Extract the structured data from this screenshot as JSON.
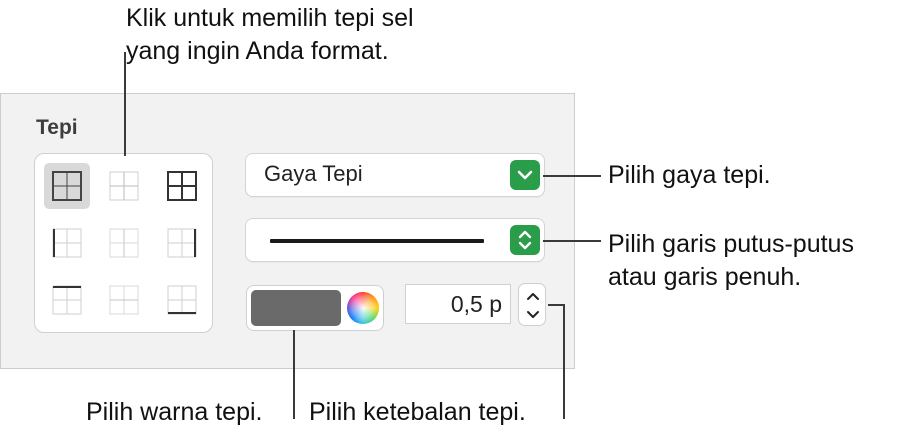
{
  "callouts": {
    "top_line1": "Klik untuk memilih tepi sel",
    "top_line2": "yang ingin Anda format.",
    "style": "Pilih gaya tepi.",
    "line_line1": "Pilih garis putus-putus",
    "line_line2": "atau garis penuh.",
    "color": "Pilih warna tepi.",
    "thickness": "Pilih ketebalan tepi."
  },
  "panel": {
    "section_title": "Tepi",
    "border_style_dropdown": "Gaya Tepi",
    "line_type": "solid",
    "thickness_value": "0,5 p",
    "border_color": "#6a6a6a",
    "accent": "#2a9d4a"
  },
  "border_buttons": [
    {
      "icon": "all-borders-icon",
      "selected": true
    },
    {
      "icon": "inside-borders-icon",
      "selected": false
    },
    {
      "icon": "all-grid-borders-icon",
      "selected": false
    },
    {
      "icon": "left-border-icon",
      "selected": false
    },
    {
      "icon": "inside-vertical-border-icon",
      "selected": false
    },
    {
      "icon": "right-border-icon",
      "selected": false
    },
    {
      "icon": "top-border-icon",
      "selected": false
    },
    {
      "icon": "inside-horizontal-border-icon",
      "selected": false
    },
    {
      "icon": "bottom-border-icon",
      "selected": false
    }
  ]
}
